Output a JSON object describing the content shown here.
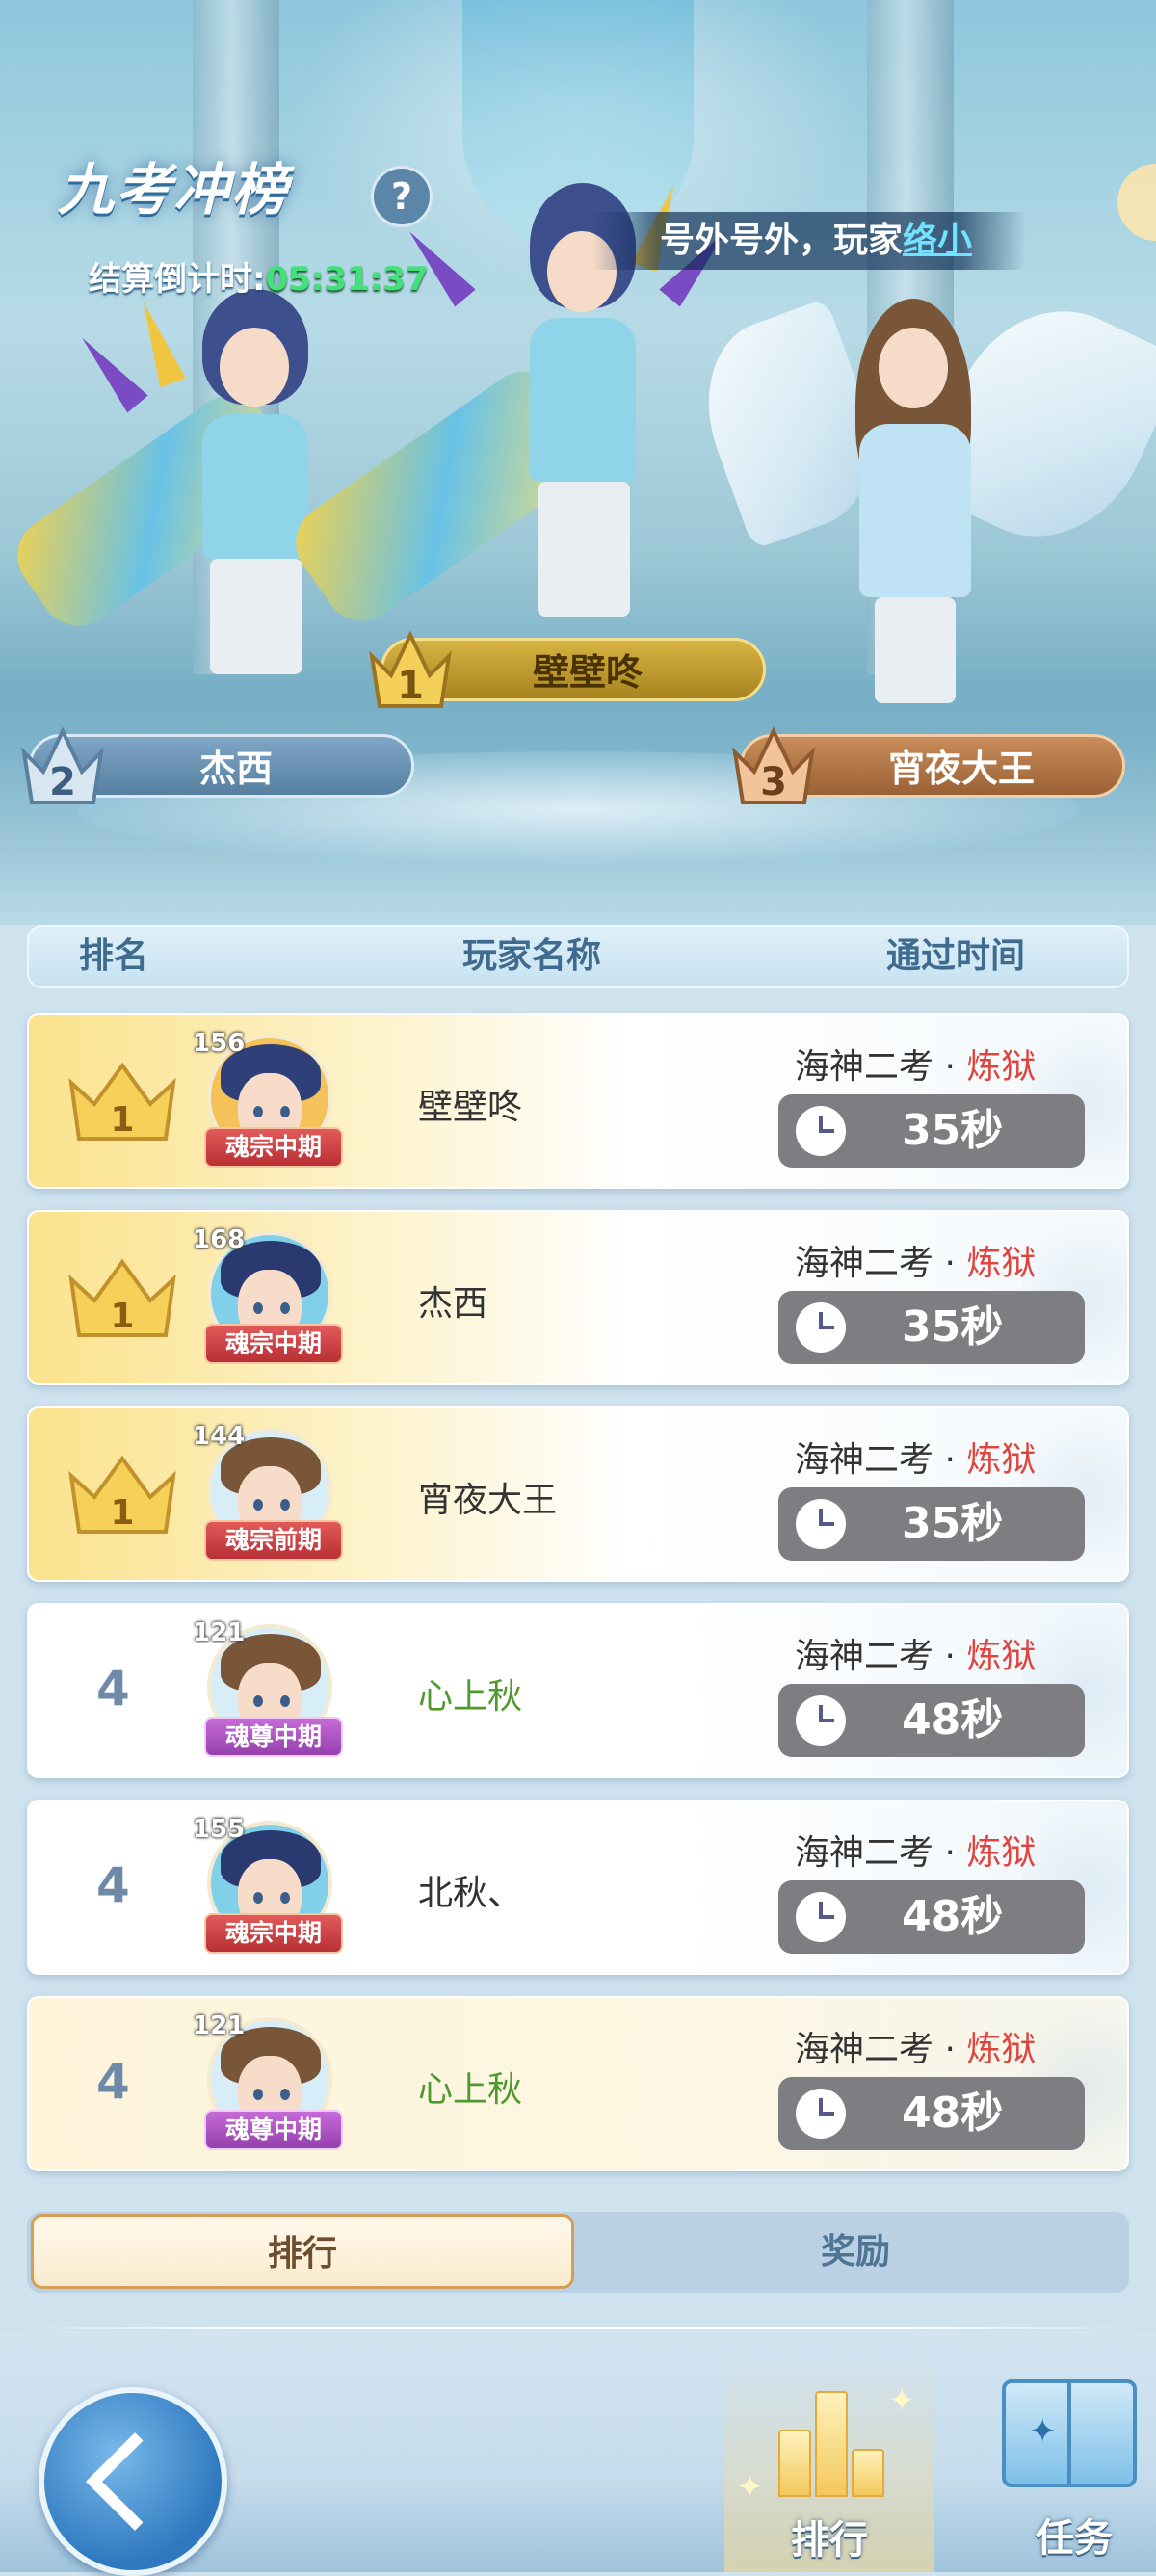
{
  "header": {
    "title": "九考冲榜",
    "help_label": "?",
    "countdown_label": "结算倒计时:",
    "countdown_value": "05:31:37",
    "ticker_text": "号外号外，玩家",
    "ticker_nick": "络小"
  },
  "podium": [
    {
      "rank": "1",
      "name": "壁壁咚"
    },
    {
      "rank": "2",
      "name": "杰西"
    },
    {
      "rank": "3",
      "name": "宵夜大王"
    }
  ],
  "columns": {
    "rank": "排名",
    "player": "玩家名称",
    "time": "通过时间"
  },
  "rows": [
    {
      "rank": "1",
      "level": "156",
      "realm": "魂宗中期",
      "name": "壁壁咚",
      "stage": "海神二考 · ",
      "difficulty": "炼狱",
      "time": "35秒"
    },
    {
      "rank": "1",
      "level": "168",
      "realm": "魂宗中期",
      "name": "杰西",
      "stage": "海神二考 · ",
      "difficulty": "炼狱",
      "time": "35秒"
    },
    {
      "rank": "1",
      "level": "144",
      "realm": "魂宗前期",
      "name": "宵夜大王",
      "stage": "海神二考 · ",
      "difficulty": "炼狱",
      "time": "35秒"
    },
    {
      "rank": "4",
      "level": "121",
      "realm": "魂尊中期",
      "name": "心上秋",
      "stage": "海神二考 · ",
      "difficulty": "炼狱",
      "time": "48秒"
    },
    {
      "rank": "4",
      "level": "155",
      "realm": "魂宗中期",
      "name": "北秋、",
      "stage": "海神二考 · ",
      "difficulty": "炼狱",
      "time": "48秒"
    },
    {
      "rank": "4",
      "level": "121",
      "realm": "魂尊中期",
      "name": "心上秋",
      "stage": "海神二考 · ",
      "difficulty": "炼狱",
      "time": "48秒"
    }
  ],
  "tabs": {
    "ranking": "排行",
    "rewards": "奖励"
  },
  "nav": {
    "ranking": "排行",
    "tasks": "任务"
  },
  "colors": {
    "accent_gold": "#d7b342",
    "difficulty_red": "#e0443f",
    "name_green": "#4f9a2e",
    "countdown_green": "#44e07a"
  }
}
